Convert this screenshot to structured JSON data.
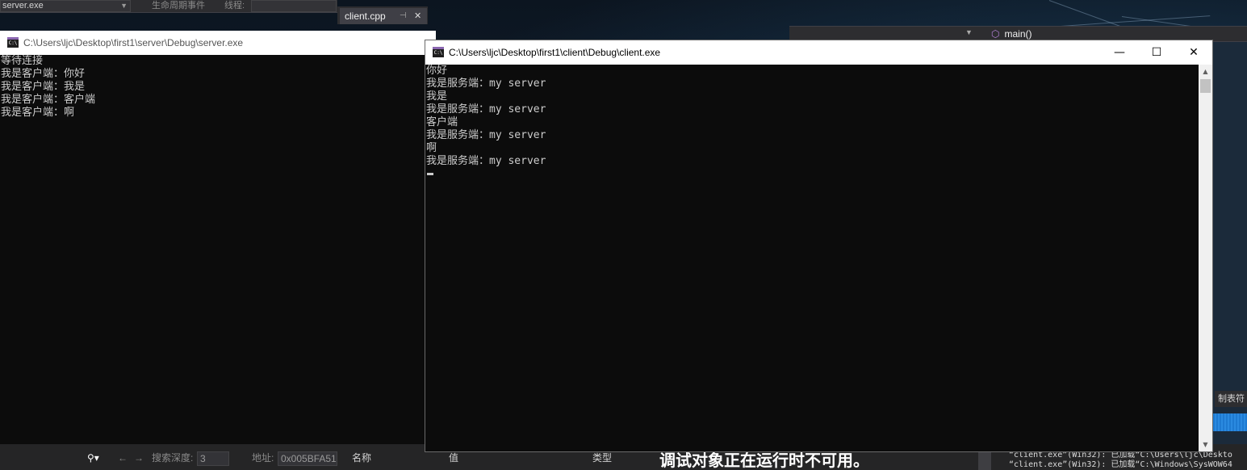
{
  "ide": {
    "process_combo": "server.exe",
    "lifecycle_label": "生命周期事件",
    "thread_label": "线程:",
    "editor_tab": "client.cpp",
    "function_nav": "main()",
    "right_tab": "制表符",
    "bottom": {
      "search_depth_label": "搜索深度:",
      "search_depth_value": "3",
      "address_label": "地址:",
      "address_value": "0x005BFA51",
      "col_name": "名称",
      "col_value": "值",
      "col_type": "类型",
      "unavailable_msg": "调试对象正在运行时不可用。",
      "output_lines": [
        "“client.exe”(Win32): 已加载“C:\\Users\\ljc\\Deskto",
        "“client.exe”(Win32): 已加载“C:\\Windows\\SysWOW64"
      ]
    }
  },
  "server_window": {
    "title": "C:\\Users\\ljc\\Desktop\\first1\\server\\Debug\\server.exe",
    "icon_text": "C:\\",
    "lines": [
      "等待连接",
      "我是客户端：你好",
      "我是客户端：我是",
      "我是客户端：客户端",
      "我是客户端：啊"
    ]
  },
  "client_window": {
    "title": "C:\\Users\\ljc\\Desktop\\first1\\client\\Debug\\client.exe",
    "icon_text": "C:\\",
    "minimize": "—",
    "maximize": "☐",
    "close": "✕",
    "lines": [
      "你好",
      "我是服务端：my server",
      "我是",
      "我是服务端：my server",
      "客户端",
      "我是服务端：my server",
      "啊",
      "我是服务端：my server"
    ]
  }
}
